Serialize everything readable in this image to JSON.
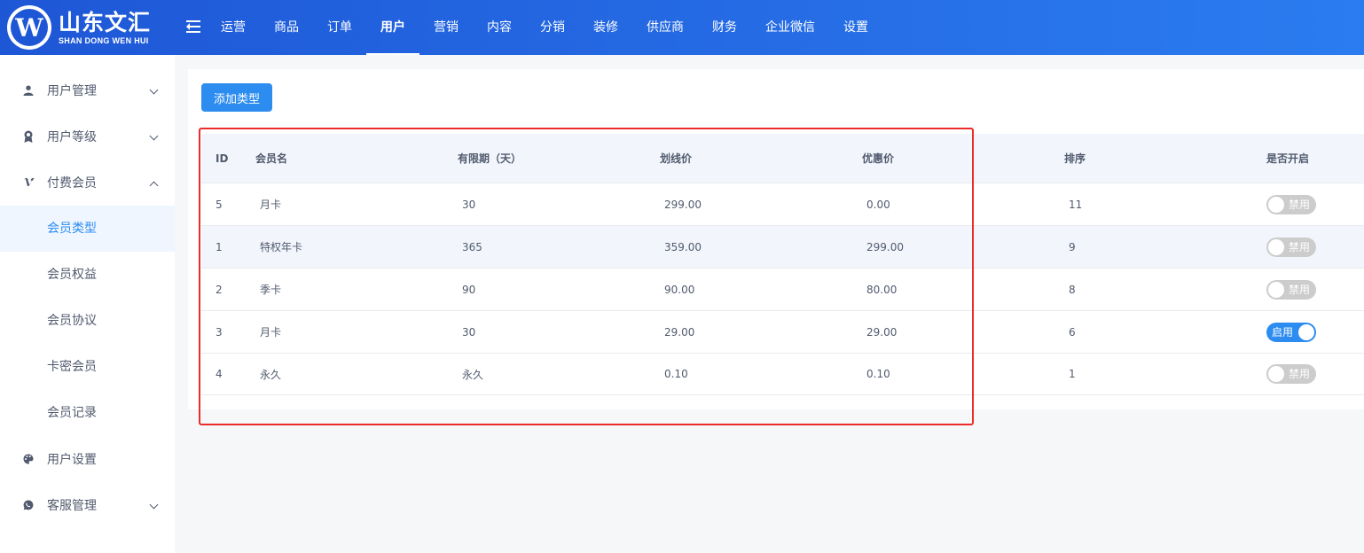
{
  "brand": {
    "logo_letter": "W",
    "name_cn": "山东文汇",
    "name_en": "SHAN DONG WEN HUI",
    "accent_color": "#2d8cf0"
  },
  "topnav": {
    "items": [
      {
        "label": "运营"
      },
      {
        "label": "商品"
      },
      {
        "label": "订单"
      },
      {
        "label": "用户",
        "active": true
      },
      {
        "label": "营销"
      },
      {
        "label": "内容"
      },
      {
        "label": "分销"
      },
      {
        "label": "装修"
      },
      {
        "label": "供应商"
      },
      {
        "label": "财务"
      },
      {
        "label": "企业微信"
      },
      {
        "label": "设置"
      }
    ]
  },
  "sidebar": {
    "groups": [
      {
        "label": "用户管理",
        "icon": "user-icon",
        "expanded": false
      },
      {
        "label": "用户等级",
        "icon": "medal-icon",
        "expanded": false
      },
      {
        "label": "付费会员",
        "icon": "vimeo-icon",
        "expanded": true,
        "children": [
          {
            "label": "会员类型",
            "active": true
          },
          {
            "label": "会员权益"
          },
          {
            "label": "会员协议"
          },
          {
            "label": "卡密会员"
          },
          {
            "label": "会员记录"
          }
        ]
      },
      {
        "label": "用户设置",
        "icon": "palette-icon"
      },
      {
        "label": "客服管理",
        "icon": "whatsapp-icon",
        "expanded": false
      }
    ]
  },
  "toolbar": {
    "add_label": "添加类型"
  },
  "table": {
    "headers": {
      "id": "ID",
      "name": "会员名",
      "days": "有限期（天）",
      "original_price": "划线价",
      "price": "优惠价",
      "sort": "排序",
      "status": "是否开启"
    },
    "rows": [
      {
        "id": "5",
        "name": "月卡",
        "days": "30",
        "original_price": "299.00",
        "price": "0.00",
        "sort": "11",
        "enabled": false,
        "status_label": "禁用"
      },
      {
        "id": "1",
        "name": "特权年卡",
        "days": "365",
        "original_price": "359.00",
        "price": "299.00",
        "sort": "9",
        "enabled": false,
        "status_label": "禁用"
      },
      {
        "id": "2",
        "name": "季卡",
        "days": "90",
        "original_price": "90.00",
        "price": "80.00",
        "sort": "8",
        "enabled": false,
        "status_label": "禁用"
      },
      {
        "id": "3",
        "name": "月卡",
        "days": "30",
        "original_price": "29.00",
        "price": "29.00",
        "sort": "6",
        "enabled": true,
        "status_label": "启用"
      },
      {
        "id": "4",
        "name": "永久",
        "days": "永久",
        "original_price": "0.10",
        "price": "0.10",
        "sort": "1",
        "enabled": false,
        "status_label": "禁用"
      }
    ]
  }
}
